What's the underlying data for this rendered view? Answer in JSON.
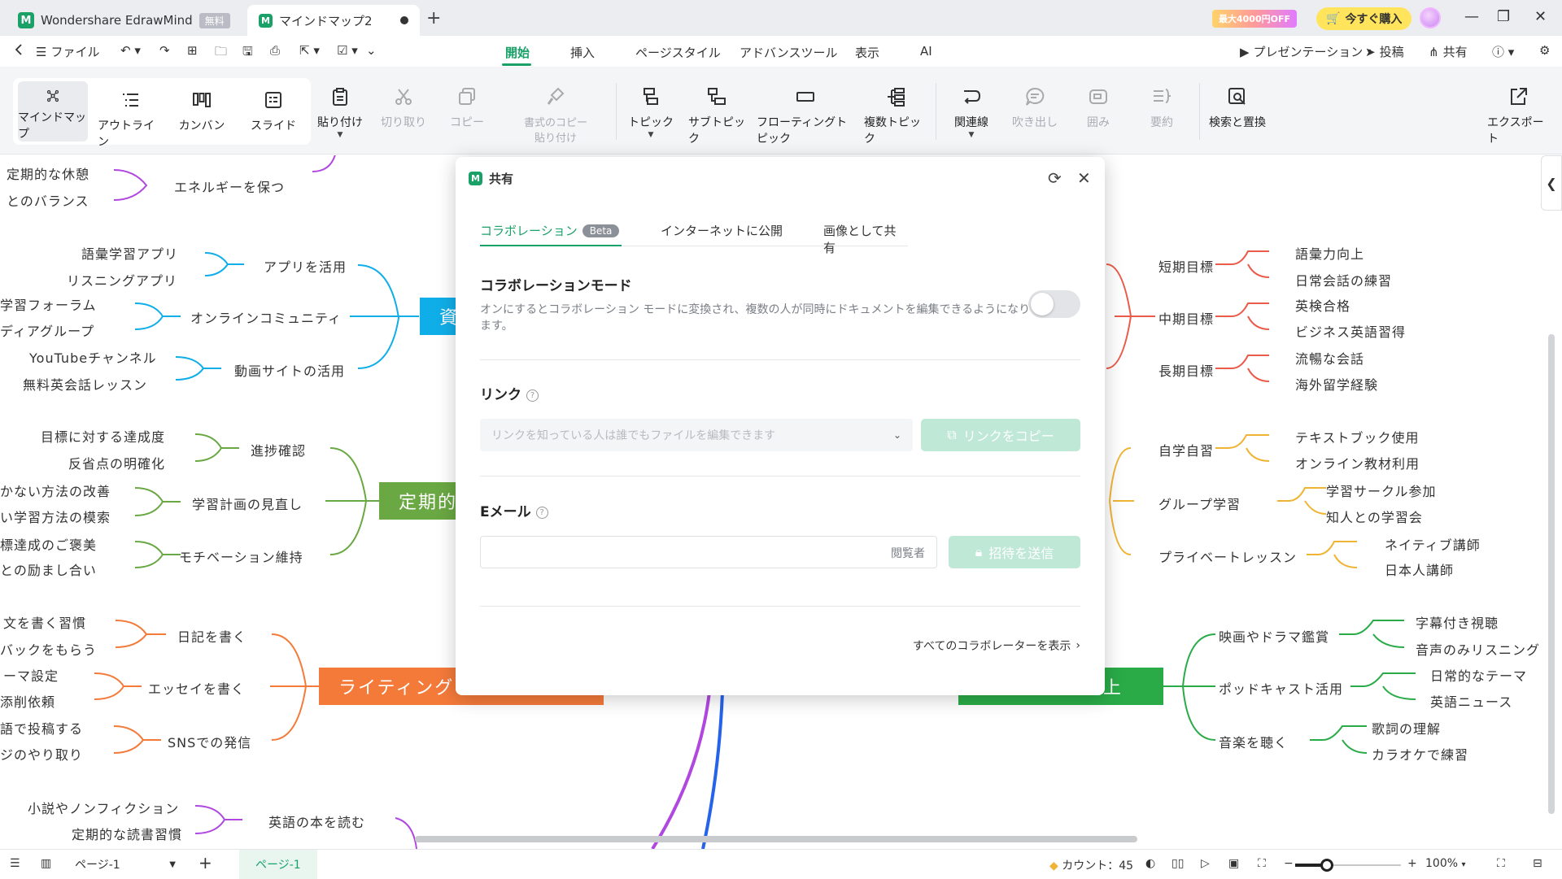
{
  "titlebar": {
    "app_name": "Wondershare EdrawMind",
    "app_badge": "無料",
    "doc_tab": "マインドマップ2",
    "promo": "最大4000円OFF",
    "buy_label": "今すぐ購入"
  },
  "menubar": {
    "file_label": "ファイル",
    "tabs": [
      "開始",
      "挿入",
      "ページスタイル",
      "アドバンスツール",
      "表示",
      "AI"
    ],
    "active_tab": "開始",
    "presentation": "プレゼンテーション",
    "post": "投稿",
    "share": "共有"
  },
  "ribbon": {
    "views": [
      "マインドマップ",
      "アウトライン",
      "カンバン",
      "スライド"
    ],
    "paste": "貼り付け",
    "cut": "切り取り",
    "copy": "コピー",
    "format_copy_1": "書式のコピー",
    "format_copy_2": "貼り付け",
    "topic": "トピック",
    "subtopic": "サブトピック",
    "floating": "フローティングトピック",
    "multi": "複数トピック",
    "relation": "関連線",
    "callout": "吹き出し",
    "boundary": "囲み",
    "summary": "要約",
    "find": "検索と置換",
    "export": "エクスポート"
  },
  "canvas": {
    "left_nodes": {
      "rest1": "定期的な休憩",
      "rest2": "とのバランス",
      "energy": "エネルギーを保つ",
      "vocab_app": "語彙学習アプリ",
      "listening_app": "リスニングアプリ",
      "use_app": "アプリを活用",
      "forum": "学習フォーラム",
      "media_group": "ディアグループ",
      "online_comm": "オンラインコミュニティ",
      "youtube": "YouTubeチャンネル",
      "free_lesson": "無料英会話レッスン",
      "video_site": "動画サイトの活用",
      "achievement": "目標に対する達成度",
      "reflection": "反省点の明確化",
      "progress": "進捗確認",
      "improve": "かない方法の改善",
      "search_method": "い学習方法の模索",
      "review_plan": "学習計画の見直し",
      "reward": "標達成のご褒美",
      "encourage": "との励まし合い",
      "motivation": "モチベーション維持",
      "essay_habit": "文を書く習慣",
      "feedback": "バックをもらう",
      "diary": "日記を書く",
      "theme": "ーマ設定",
      "correction": "添削依頼",
      "essay": "エッセイを書く",
      "post_en": "語で投稿する",
      "messages": "ジのやり取り",
      "sns": "SNSでの発信",
      "novel": "小説やノンフィクション",
      "reading_habit": "定期的な読書習慣",
      "read_books": "英語の本を読む"
    },
    "right_nodes": {
      "short_goal": "短期目標",
      "vocab_up": "語彙力向上",
      "daily_conv": "日常会話の練習",
      "mid_goal": "中期目標",
      "eiken": "英検合格",
      "business": "ビジネス英語習得",
      "long_goal": "長期目標",
      "fluent": "流暢な会話",
      "abroad": "海外留学経験",
      "self_study": "自学自習",
      "textbook": "テキストブック使用",
      "online_mat": "オンライン教材利用",
      "group_study": "グループ学習",
      "circle": "学習サークル参加",
      "friends": "知人との学習会",
      "private": "プライベートレッスン",
      "native": "ネイティブ講師",
      "japanese": "日本人講師",
      "movies": "映画やドラマ鑑賞",
      "subtitles": "字幕付き視聴",
      "audio_only": "音声のみリスニング",
      "podcast": "ポッドキャスト活用",
      "daily_theme": "日常的なテーマ",
      "news": "英語ニュース",
      "music": "音楽を聴く",
      "lyrics": "歌詞の理解",
      "karaoke": "カラオケで練習"
    },
    "topics": {
      "blue": "資",
      "green_left": "定期的",
      "orange": "ライティング",
      "green_right": "上"
    },
    "colors": {
      "blue": "#10aee8",
      "green_left": "#6aa843",
      "orange": "#f47a3a",
      "green_right": "#2aab48",
      "red_branch": "#ea5b4a",
      "yellow_branch": "#f0b435",
      "purple": "#b048e0"
    }
  },
  "dialog": {
    "title": "共有",
    "tabs": [
      "コラボレーション",
      "インターネットに公開",
      "画像として共有"
    ],
    "beta": "Beta",
    "collab_title": "コラボレーションモード",
    "collab_desc": "オンにするとコラボレーション モードに変換され、複数の人が同時にドキュメントを編集できるようになります。",
    "collab_enabled": false,
    "link_title": "リンク",
    "link_permission": "リンクを知っている人は誰でもファイルを編集できます",
    "copy_link": "リンクをコピー",
    "email_title": "Eメール",
    "email_value": "",
    "email_role": "閲覧者",
    "send_invite": "招待を送信",
    "show_all": "すべてのコラボレーターを表示"
  },
  "statusbar": {
    "page_select": "ページ-1",
    "page_tab": "ページ-1",
    "count_label": "カウント：45",
    "zoom": "100%",
    "zoom_level": 0.3
  }
}
